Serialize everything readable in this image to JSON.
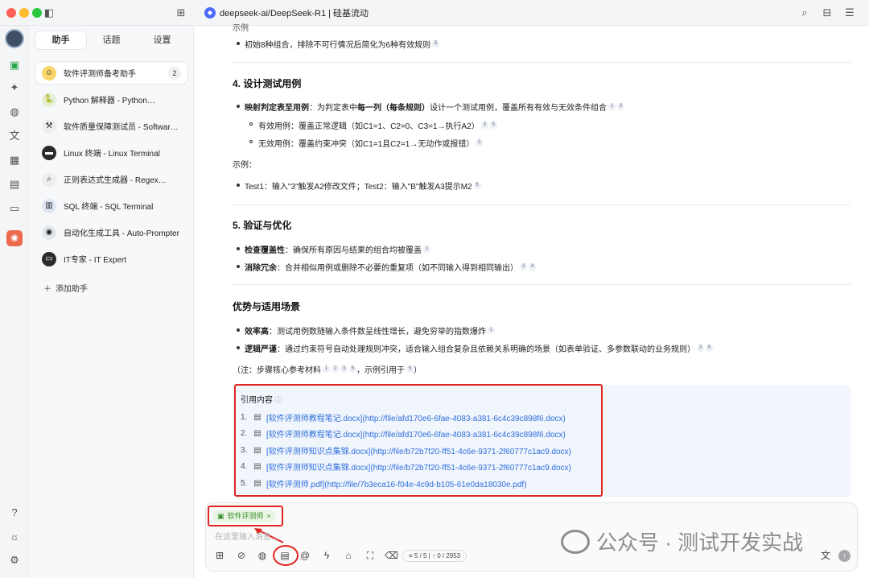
{
  "window": {
    "title": "deepseek-ai/DeepSeek-R1 | 硅基流动"
  },
  "panel": {
    "tabs": [
      "助手",
      "话题",
      "设置"
    ],
    "assistants": [
      {
        "name": "软件评测师备考助手",
        "icon": "smile-emoji-icon",
        "badge": "2"
      },
      {
        "name": "Python 解释器 - Python…",
        "icon": "python-icon"
      },
      {
        "name": "软件质量保障测试员 - Software…",
        "icon": "tools-icon"
      },
      {
        "name": "Linux 终端 - Linux Terminal",
        "icon": "terminal-icon"
      },
      {
        "name": "正则表达式生成器 - Regex…",
        "icon": "magnifier-icon"
      },
      {
        "name": "SQL 终端 - SQL Terminal",
        "icon": "chart-icon"
      },
      {
        "name": "自动化生成工具 - Auto-Prompter",
        "icon": "robot-icon"
      },
      {
        "name": "IT专家 - IT Expert",
        "icon": "computer-icon"
      }
    ],
    "add_label": "添加助手"
  },
  "content": {
    "top_fragment": "示例",
    "top_bullet": "初始8种组合，排除不可行情况后简化为6种有效规则",
    "s4_heading": "4. 设计测试用例",
    "s4_b1_bold": "映射判定表至用例",
    "s4_b1_text": "：为判定表中",
    "s4_b1_bold2": "每一列（每条规则）",
    "s4_b1_text2": "设计一个测试用例，覆盖所有有效与无效条件组合",
    "s4_sub1": "有效用例：覆盖正常逻辑（如C1=1、C2=0、C3=1→执行A2）",
    "s4_sub2": "无效用例：覆盖约束冲突（如C1=1且C2=1→无动作或报错）",
    "example_label": "示例：",
    "example_bullet": "Test1：输入\"3\"触发A2修改文件；Test2：输入\"B\"触发A3提示M2",
    "s5_heading": "5. 验证与优化",
    "s5_b1_bold": "检查覆盖性",
    "s5_b1_text": "：确保所有原因与结果的组合均被覆盖",
    "s5_b2_bold": "消除冗余",
    "s5_b2_text": "：合并相似用例或删除不必要的重复项（如不同输入得到相同输出）",
    "adv_heading": "优势与适用场景",
    "adv_b1_bold": "效率高",
    "adv_b1_text": "：测试用例数随输入条件数呈线性增长，避免穷举的指数爆炸",
    "adv_b2_bold": "逻辑严谨",
    "adv_b2_text": "：通过约束符号自动处理规则冲突，适合输入组合复杂且依赖关系明确的场景（如表单验证、多参数联动的业务规则）",
    "note_text": "（注：步骤核心参考材料",
    "note_text2": "，示例引用于",
    "note_end": "）"
  },
  "citations": {
    "title": "引用内容",
    "items": [
      {
        "num": "1.",
        "text": "[软件评测师教程笔记.docx](http://file/afd170e6-6fae-4083-a381-6c4c39c898f6.docx)"
      },
      {
        "num": "2.",
        "text": "[软件评测师教程笔记.docx](http://file/afd170e6-6fae-4083-a381-6c4c39c898f6.docx)"
      },
      {
        "num": "3.",
        "text": "[软件评测师知识点集锦.docx](http://file/b72b7f20-ff51-4c6e-9371-2f60777c1ac9.docx)"
      },
      {
        "num": "4.",
        "text": "[软件评测师知识点集锦.docx](http://file/b72b7f20-ff51-4c6e-9371-2f60777c1ac9.docx)"
      },
      {
        "num": "5.",
        "text": "[软件评测师.pdf](http://file/7b3eca16-f04e-4c9d-b105-61e0da18030e.pdf)"
      }
    ]
  },
  "input": {
    "chip_label": "软件评测师",
    "placeholder": "在这里输入消息...",
    "counter": "≡ 5 / 5 | ↑ 0 / 2953"
  },
  "watermark": "公众号 · 测试开发实战",
  "colors": {
    "accent": "#2f6fde",
    "highlight": "#e0261f",
    "chip": "#3a8d2c"
  }
}
